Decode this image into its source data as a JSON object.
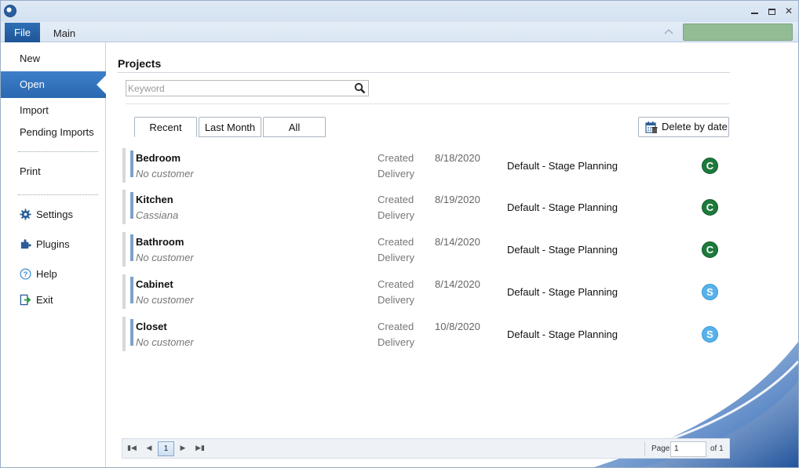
{
  "window": {
    "min_glyph": "",
    "close_glyph": "✕"
  },
  "ribbon": {
    "file_tab": "File",
    "main_tab": "Main"
  },
  "sidebar": {
    "items": [
      {
        "label": "New"
      },
      {
        "label": "Open"
      },
      {
        "label": "Import"
      },
      {
        "label": "Pending Imports"
      },
      {
        "label": "Print"
      },
      {
        "label": "Settings",
        "icon": "gear-icon"
      },
      {
        "label": "Plugins",
        "icon": "puzzle-icon"
      },
      {
        "label": "Help",
        "icon": "help-icon"
      },
      {
        "label": "Exit",
        "icon": "exit-icon"
      }
    ]
  },
  "main": {
    "title": "Projects",
    "search": {
      "placeholder": "Keyword",
      "value": ""
    },
    "tabs": [
      {
        "label": "Recent"
      },
      {
        "label": "Last Month"
      },
      {
        "label": "All"
      }
    ],
    "delete_by_date_label": "Delete by date",
    "created_label": "Created",
    "delivery_label": "Delivery",
    "projects": [
      {
        "name": "Bedroom",
        "customer": "No customer",
        "created": "8/18/2020",
        "process": "Default - Stage Planning",
        "badge": "C",
        "badge_color": "#1d7a3c"
      },
      {
        "name": "Kitchen",
        "customer": "Cassiana",
        "created": "8/19/2020",
        "process": "Default - Stage Planning",
        "badge": "C",
        "badge_color": "#1d7a3c"
      },
      {
        "name": "Bathroom",
        "customer": "No customer",
        "created": "8/14/2020",
        "process": "Default - Stage Planning",
        "badge": "C",
        "badge_color": "#1d7a3c"
      },
      {
        "name": "Cabinet",
        "customer": "No customer",
        "created": "8/14/2020",
        "process": "Default - Stage Planning",
        "badge": "S",
        "badge_color": "#59b1ea"
      },
      {
        "name": "Closet",
        "customer": "No customer",
        "created": "10/8/2020",
        "process": "Default - Stage Planning",
        "badge": "S",
        "badge_color": "#59b1ea"
      }
    ]
  },
  "pager": {
    "current_page_button": "1",
    "page_label": "Page",
    "page_value": "1",
    "of_label": "of 1"
  },
  "colors": {
    "accent": "#2a68b0",
    "ribbon_status": "#94bc94"
  }
}
